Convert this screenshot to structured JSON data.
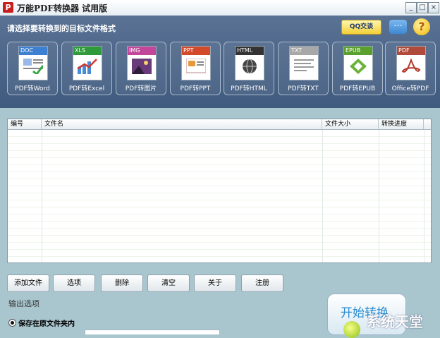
{
  "window": {
    "title": "万能PDF转换器 试用版",
    "app_icon_glyph": "P"
  },
  "header": {
    "prompt": "请选择要转换到的目标文件格式",
    "qq_label": "QQ交谈",
    "chat_icon": "chat-bubble-icon",
    "help_icon": "question-icon"
  },
  "formats": [
    {
      "tag": "DOC",
      "label": "PDF转Word",
      "color": "#3d7fd0"
    },
    {
      "tag": "XLS",
      "label": "PDF转Excel",
      "color": "#2e9a3a"
    },
    {
      "tag": "IMG",
      "label": "PDF转图片",
      "color": "#c2479b"
    },
    {
      "tag": "PPT",
      "label": "PDF转PPT",
      "color": "#d24a2a"
    },
    {
      "tag": "HTML",
      "label": "PDF转HTML",
      "color": "#333333"
    },
    {
      "tag": "TXT",
      "label": "PDF转TXT",
      "color": "#a8a8a8"
    },
    {
      "tag": "EPUB",
      "label": "PDF转EPUB",
      "color": "#5aa02c"
    },
    {
      "tag": "PDF",
      "label": "Office转PDF",
      "color": "#b04a3a"
    }
  ],
  "table": {
    "columns": [
      "编号",
      "文件名",
      "文件大小",
      "转换进度"
    ]
  },
  "buttons": {
    "add": "添加文件",
    "options": "选项",
    "delete": "删除",
    "clear": "清空",
    "about": "关于",
    "register": "注册"
  },
  "output": {
    "title": "输出选项",
    "save_in_source": "保存在原文件夹内"
  },
  "start": {
    "label": "开始转换"
  },
  "watermark": "系统天堂"
}
